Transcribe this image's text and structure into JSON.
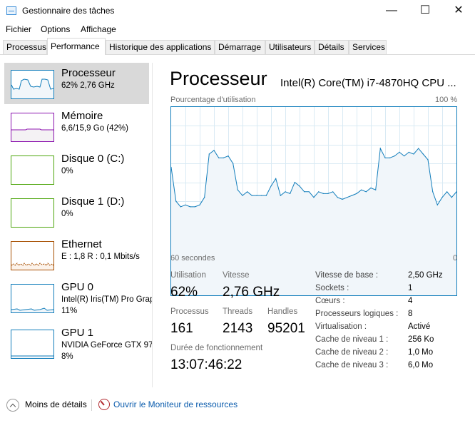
{
  "window": {
    "title": "Gestionnaire des tâches",
    "minimize_glyph": "—",
    "maximize_glyph": "☐",
    "close_glyph": "✕"
  },
  "menu": [
    "Fichier",
    "Options",
    "Affichage"
  ],
  "tabs": [
    "Processus",
    "Performance",
    "Historique des applications",
    "Démarrage",
    "Utilisateurs",
    "Détails",
    "Services"
  ],
  "active_tab": "Performance",
  "sidebar": [
    {
      "title": "Processeur",
      "line1": "62%  2,76 GHz",
      "line2": "",
      "color": "#117dbb",
      "fill": "#f1f6fa"
    },
    {
      "title": "Mémoire",
      "line1": "6,6/15,9 Go (42%)",
      "line2": "",
      "color": "#8b12ae",
      "fill": "#f4f2f4"
    },
    {
      "title": "Disque 0 (C:)",
      "line1": "0%",
      "line2": "",
      "color": "#4da60c",
      "fill": "#eff7ea"
    },
    {
      "title": "Disque 1 (D:)",
      "line1": "0%",
      "line2": "",
      "color": "#4da60c",
      "fill": "#eff7ea"
    },
    {
      "title": "Ethernet",
      "line1": "E : 1,8  R : 0,1 Mbits/s",
      "line2": "",
      "color": "#a74f01",
      "fill": "#fcf3eb"
    },
    {
      "title": "GPU 0",
      "line1": "Intel(R) Iris(TM) Pro Graphics",
      "line2": "11%",
      "color": "#117dbb",
      "fill": "#f1f6fa"
    },
    {
      "title": "GPU 1",
      "line1": "NVIDIA GeForce GTX 970M",
      "line2": "8%",
      "color": "#117dbb",
      "fill": "#f1f6fa"
    }
  ],
  "main": {
    "title": "Processeur",
    "cpu_name": "Intel(R) Core(TM) i7-4870HQ CPU ...",
    "graph_label_left": "Pourcentage d'utilisation",
    "graph_label_right": "100 %",
    "graph_bottom_left": "60 secondes",
    "graph_bottom_right": "0"
  },
  "stats": {
    "utilisation_label": "Utilisation",
    "utilisation_value": "62%",
    "vitesse_label": "Vitesse",
    "vitesse_value": "2,76 GHz",
    "processus_label": "Processus",
    "processus_value": "161",
    "threads_label": "Threads",
    "threads_value": "2143",
    "handles_label": "Handles",
    "handles_value": "95201",
    "uptime_label": "Durée de fonctionnement",
    "uptime_value": "13:07:46:22"
  },
  "specs": [
    {
      "label": "Vitesse de base :",
      "value": "2,50 GHz"
    },
    {
      "label": "Sockets :",
      "value": "1"
    },
    {
      "label": "Cœurs :",
      "value": "4"
    },
    {
      "label": "Processeurs logiques :",
      "value": "8"
    },
    {
      "label": "Virtualisation :",
      "value": "Activé"
    },
    {
      "label": "Cache de niveau 1 :",
      "value": "256 Ko"
    },
    {
      "label": "Cache de niveau 2 :",
      "value": "1,0 Mo"
    },
    {
      "label": "Cache de niveau 3 :",
      "value": "6,0 Mo"
    }
  ],
  "footer": {
    "less_details": "Moins de détails",
    "resource_monitor": "Ouvrir le Moniteur de ressources"
  },
  "chart_data": {
    "type": "area",
    "ylim": [
      0,
      100
    ],
    "x": [
      60,
      59,
      58,
      57,
      56,
      55,
      54,
      53,
      52,
      51,
      50,
      49,
      48,
      47,
      46,
      45,
      44,
      43,
      42,
      41,
      40,
      39,
      38,
      37,
      36,
      35,
      34,
      33,
      32,
      31,
      30,
      29,
      28,
      27,
      26,
      25,
      24,
      23,
      22,
      21,
      20,
      19,
      18,
      17,
      16,
      15,
      14,
      13,
      12,
      11,
      10,
      9,
      8,
      7,
      6,
      5,
      4,
      3,
      2,
      1,
      0
    ],
    "values": [
      68,
      50,
      47,
      48,
      47,
      47,
      48,
      52,
      75,
      77,
      73,
      73,
      74,
      70,
      56,
      53,
      55,
      53,
      53,
      53,
      53,
      58,
      62,
      53,
      55,
      54,
      60,
      58,
      55,
      55,
      52,
      55,
      54,
      54,
      55,
      52,
      51,
      52,
      53,
      54,
      56,
      55,
      57,
      56,
      78,
      73,
      73,
      74,
      76,
      74,
      76,
      75,
      78,
      75,
      72,
      55,
      48,
      52,
      55,
      52,
      55
    ]
  }
}
